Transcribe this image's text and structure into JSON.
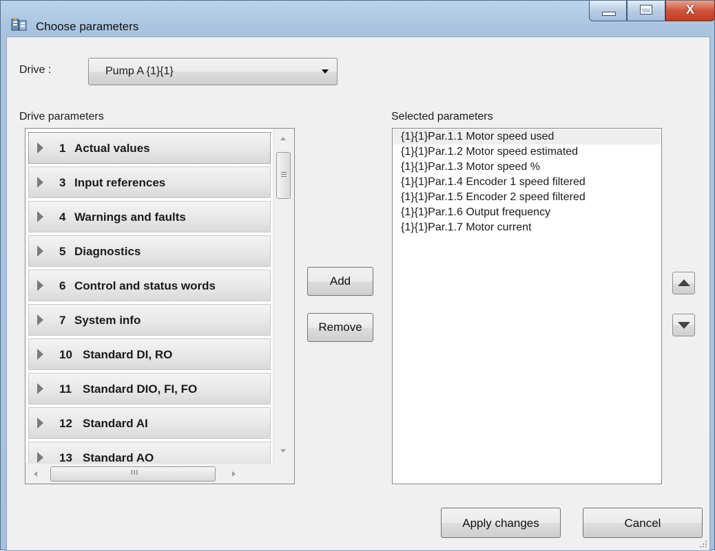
{
  "window": {
    "title": "Choose parameters",
    "minimize_label": "",
    "maximize_label": "",
    "close_label": "X"
  },
  "drive": {
    "label": "Drive :",
    "selected": "Pump A {1}{1}"
  },
  "drive_parameters": {
    "label": "Drive parameters",
    "groups": [
      {
        "num": "1",
        "name": "Actual values"
      },
      {
        "num": "3",
        "name": "Input references"
      },
      {
        "num": "4",
        "name": "Warnings and faults"
      },
      {
        "num": "5",
        "name": "Diagnostics"
      },
      {
        "num": "6",
        "name": "Control and status words"
      },
      {
        "num": "7",
        "name": "System info"
      },
      {
        "num": "10",
        "name": "Standard DI, RO"
      },
      {
        "num": "11",
        "name": "Standard DIO, FI, FO"
      },
      {
        "num": "12",
        "name": "Standard AI"
      },
      {
        "num": "13",
        "name": "Standard AO"
      }
    ],
    "hscroll_grip": "III"
  },
  "actions": {
    "add": "Add",
    "remove": "Remove"
  },
  "selected_parameters": {
    "label": "Selected parameters",
    "items": [
      "{1}{1}Par.1.1  Motor speed used",
      "{1}{1}Par.1.2  Motor speed estimated",
      "{1}{1}Par.1.3  Motor speed %",
      "{1}{1}Par.1.4  Encoder 1 speed filtered",
      "{1}{1}Par.1.5  Encoder 2 speed filtered",
      "{1}{1}Par.1.6  Output frequency",
      "{1}{1}Par.1.7  Motor current"
    ]
  },
  "footer": {
    "apply": "Apply changes",
    "cancel": "Cancel"
  },
  "colors": {
    "title_bar": "#a9c4df",
    "close_button": "#c23a22",
    "client_bg": "#f0f0f0"
  }
}
